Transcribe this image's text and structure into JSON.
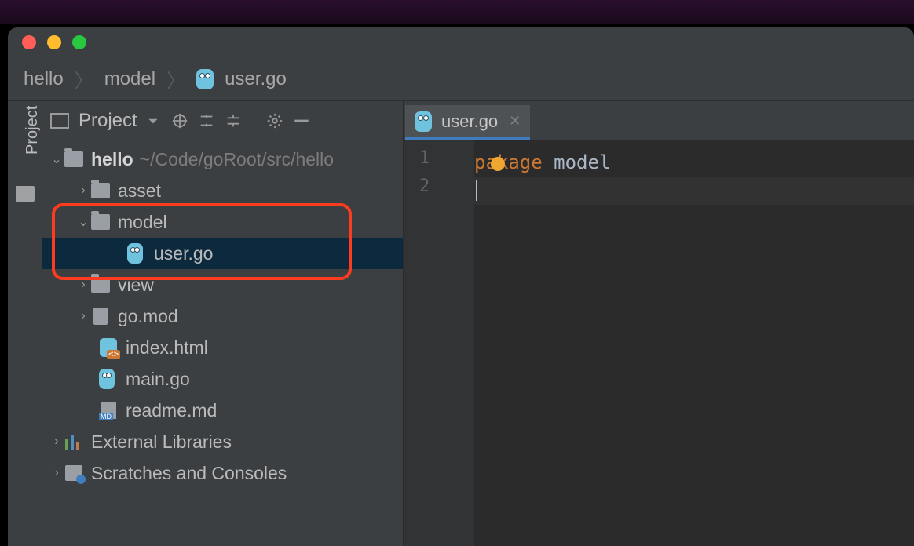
{
  "breadcrumbs": [
    "hello",
    "model",
    "user.go"
  ],
  "panel": {
    "title": "Project"
  },
  "tree": {
    "root": {
      "name": "hello",
      "path": "~/Code/goRoot/src/hello"
    },
    "children": [
      {
        "name": "asset",
        "type": "folder",
        "expanded": false
      },
      {
        "name": "model",
        "type": "folder",
        "expanded": true,
        "children": [
          {
            "name": "user.go",
            "type": "go",
            "selected": true
          }
        ]
      },
      {
        "name": "view",
        "type": "folder",
        "expanded": false
      },
      {
        "name": "go.mod",
        "type": "file"
      },
      {
        "name": "index.html",
        "type": "html"
      },
      {
        "name": "main.go",
        "type": "go"
      },
      {
        "name": "readme.md",
        "type": "md"
      }
    ],
    "external": "External Libraries",
    "scratches": "Scratches and Consoles"
  },
  "tabs": [
    {
      "name": "user.go",
      "active": true
    }
  ],
  "code": {
    "lines": [
      {
        "n": "1",
        "tokens": [
          {
            "t": "package ",
            "cls": "kw"
          },
          {
            "t": "model",
            "cls": "ident"
          }
        ]
      },
      {
        "n": "2",
        "tokens": []
      }
    ]
  },
  "toolstrip": {
    "label": "Project"
  }
}
